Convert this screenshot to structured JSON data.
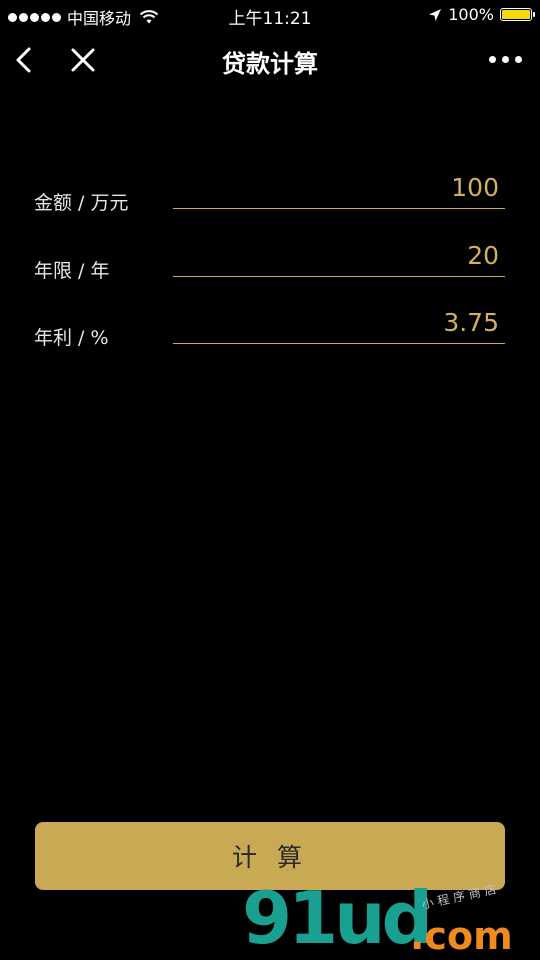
{
  "status_bar": {
    "carrier": "中国移动",
    "time": "上午11:21",
    "battery_percent": "100%",
    "battery_level": 1.0,
    "battery_color": "#f5d90a"
  },
  "nav": {
    "title": "贷款计算",
    "back_icon": "chevron-left-icon",
    "close_icon": "close-icon",
    "more_icon": "more-dots-icon"
  },
  "form": {
    "fields": [
      {
        "label": "金额 / 万元",
        "value": "100"
      },
      {
        "label": "年限 / 年",
        "value": "20"
      },
      {
        "label": "年利 / %",
        "value": "3.75"
      }
    ]
  },
  "actions": {
    "calculate_label": "计 算"
  },
  "watermark": {
    "brand": "91ud",
    "domain": ".com",
    "tagline": "小程序商店"
  },
  "colors": {
    "background": "#000000",
    "accent_gold": "#caa955",
    "value_gold": "#d4b05c"
  }
}
